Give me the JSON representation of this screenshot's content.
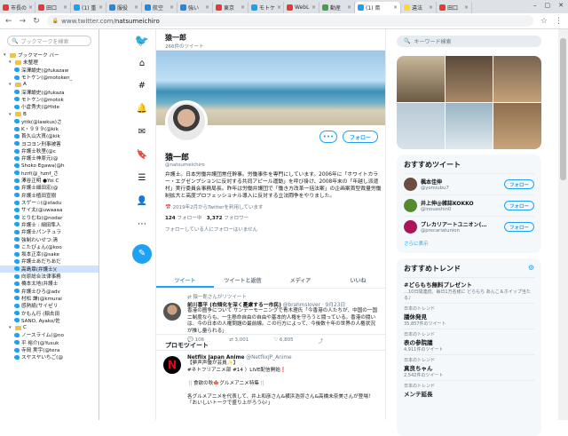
{
  "browser": {
    "tabs": [
      {
        "label": "市長の",
        "color": "#e53935"
      },
      {
        "label": "田口",
        "color": "#e53935"
      },
      {
        "label": "(1) 重",
        "color": "#1da1f2"
      },
      {
        "label": "服役",
        "color": "#1e88e5"
      },
      {
        "label": "航空",
        "color": "#1e88e5"
      },
      {
        "label": "強い",
        "color": "#1e88e5"
      },
      {
        "label": "東京",
        "color": "#e53935"
      },
      {
        "label": "モトケ",
        "color": "#1da1f2"
      },
      {
        "label": "WebL",
        "color": "#e53935"
      },
      {
        "label": "動産",
        "color": "#43a047"
      },
      {
        "label": "(1) 斎",
        "color": "#1da1f2",
        "active": true
      },
      {
        "label": "違法",
        "color": "#fdd835"
      },
      {
        "label": "田口",
        "color": "#e53935"
      }
    ],
    "url_host": "www.twitter.com/",
    "url_path": "natsumeichiro"
  },
  "bookmarks": {
    "search_placeholder": "ブックマークを検索",
    "items": [
      {
        "label": "ブックマーク バー",
        "type": "folder",
        "indent": 0
      },
      {
        "label": "未整理",
        "type": "folder",
        "indent": 1
      },
      {
        "label": "深澤諭史(@fukazaw",
        "type": "tw",
        "indent": 2
      },
      {
        "label": "モトケン(@motoken_",
        "type": "tw",
        "indent": 2
      },
      {
        "label": "A",
        "type": "folder",
        "indent": 1
      },
      {
        "label": "深澤諭史(@fukaza",
        "type": "tw",
        "indent": 2
      },
      {
        "label": "モトケン(@motok",
        "type": "tw",
        "indent": 2
      },
      {
        "label": "小倉秀夫(@Hide",
        "type": "tw",
        "indent": 2
      },
      {
        "label": "B",
        "type": "folder",
        "indent": 1
      },
      {
        "label": "yttk(@lawkus)さ",
        "type": "tw",
        "indent": 2
      },
      {
        "label": "K・９９９(@kik",
        "type": "tw",
        "indent": 2
      },
      {
        "label": "首久山大貫(@kik",
        "type": "tw",
        "indent": 2
      },
      {
        "label": "ヨコヨン刑事被害",
        "type": "tw",
        "indent": 2
      },
      {
        "label": "弁護士秋里(@c",
        "type": "tw",
        "indent": 2
      },
      {
        "label": "弁護士神原元(@",
        "type": "tw",
        "indent": 2
      },
      {
        "label": "Shoko Egawa(@h",
        "type": "tw",
        "indent": 2
      },
      {
        "label": "hzrf(@_hznf_さ",
        "type": "tw",
        "indent": 2
      },
      {
        "label": "澤谷正明 ●Yoi C",
        "type": "tw",
        "indent": 2
      },
      {
        "label": "弁護士細田宏(@",
        "type": "tw",
        "indent": 2
      },
      {
        "label": "弁護士植田宣樹",
        "type": "tw",
        "indent": 2
      },
      {
        "label": "スゲー☆(@stadu",
        "type": "tw",
        "indent": 2
      },
      {
        "label": "サイ太(@uwaaaa",
        "type": "tw",
        "indent": 2
      },
      {
        "label": "とりむね(@nodar",
        "type": "tw",
        "indent": 2
      },
      {
        "label": "弁護士 : 細田隼人",
        "type": "tw",
        "indent": 2
      },
      {
        "label": "弁護士パンチュラ",
        "type": "tw",
        "indent": 2
      },
      {
        "label": "強制わいせつ:清",
        "type": "tw",
        "indent": 2
      },
      {
        "label": "こたびょん(@koo",
        "type": "tw",
        "indent": 2
      },
      {
        "label": "坂本正幸(@sake",
        "type": "tw",
        "indent": 2
      },
      {
        "label": "弁護士あだちあだ",
        "type": "tw",
        "indent": 2
      },
      {
        "label": "高島章(弁護士)(",
        "type": "tw",
        "indent": 2,
        "selected": true
      },
      {
        "label": "向原総合法律事務",
        "type": "tw",
        "indent": 2
      },
      {
        "label": "橋本太地(弁護士",
        "type": "tw",
        "indent": 2
      },
      {
        "label": "弁護士ひろ@adv",
        "type": "tw",
        "indent": 2
      },
      {
        "label": "村松 謙(@kmurai",
        "type": "tw",
        "indent": 2
      },
      {
        "label": "感熱紙(サイゼリ",
        "type": "tw",
        "indent": 2
      },
      {
        "label": "かもん行 (稲去田",
        "type": "tw",
        "indent": 2
      },
      {
        "label": "SANO, Ayako/佐",
        "type": "tw",
        "indent": 2
      },
      {
        "label": "C",
        "type": "folder",
        "indent": 1
      },
      {
        "label": "ノースライム(@no",
        "type": "tw",
        "indent": 2
      },
      {
        "label": "平 裕介(@Yusuk",
        "type": "tw",
        "indent": 2
      },
      {
        "label": "寺岡 実宇(@tera",
        "type": "tw",
        "indent": 2
      },
      {
        "label": "スヤスヤいちご(@",
        "type": "tw",
        "indent": 2
      }
    ]
  },
  "profile": {
    "header_name": "猿一郎",
    "header_tweets": "266件のツイート",
    "name": "猿一郎",
    "handle": "@natsumeichiro",
    "more_label": "•••",
    "follow_label": "フォロー",
    "bio": "弁護士。日本労働弁護団常任幹事。労働事件を専門にしています。2006年に「ホワイトカラー・エグゼンプションに反対する共同アピール運動」を呼び掛け、2008年末の「年越し派遣村」実行委員会事務局長。昨年は労働弁護団で「働き方改革一括法案」の企画案首型裁量労働制拡大と高度プロフェッショナル導入に反対する立法闘争をやりました。",
    "joined": "2019年2月からTwitterを利用しています",
    "following_count": "124",
    "following_label": "フォロー中",
    "followers_count": "3,372",
    "followers_label": "フォロワー",
    "no_follow_note": "フォローしている人にフォローはいません"
  },
  "profile_tabs": [
    "ツイート",
    "ツイートと返信",
    "メディア",
    "いいね"
  ],
  "retweet": {
    "label": "猿一郎さんがリツイート",
    "name": "前川喜平 (右傾化を深く憂慮する一市民)",
    "handle": "@brahmslover",
    "date": "9月23日",
    "body": "香港の圏争について サンデーモーニングで青木理氏「今香港の人たちが、中国の一国二制度ならも、一生懸命自由の自由や基本的人権を守ろうと闘っている。香港の闘いは、今の日本の人権問題の最前線。この行方によって、今後数十年の世界の人権状況が推し量られる」",
    "replies": "106",
    "retweets": "3,001",
    "likes": "6,805"
  },
  "promo": {
    "label": "プロモツイート",
    "name": "Netflix Japan Anime",
    "handle": "@NetflixJP_Anime",
    "lines": [
      "【夢声声優が芸員✨】",
      "#ネトフリアニメ部 #14 〉LIVE配信開始❗",
      "",
      "🍴食欲の秋🍁グルメアニメ特集🍴",
      "",
      "各グルメアニメを代表して、井上和彦さん&横浜浩弥さん&高橋未奈美さんが登場！",
      "「おいしいトークで盛り上がろう🎶」"
    ]
  },
  "right": {
    "search_placeholder": "キーワード検索",
    "rec_title": "おすすめツイート",
    "recs": [
      {
        "name": "楓本佳伸",
        "handle": "@yomiubu7",
        "follow": "フォロー",
        "color": "#6d4c41"
      },
      {
        "name": "井上伸@雑誌KOKKO",
        "handle": "@inoueshin0",
        "follow": "フォロー",
        "color": "#558b2f"
      },
      {
        "name": "プレカリアートユニオン(…",
        "handle": "@precariatunion",
        "follow": "フォロー",
        "color": "#ad1457"
      }
    ],
    "more": "さらに表示",
    "trend_title": "おすすめトレンド",
    "trends": [
      {
        "cat": "",
        "name": "#どらもち無料プレゼント",
        "sub": "…10日間連続、毎日1万名様に どらもち あんこ＆ホイップ当たる♪"
      },
      {
        "cat": "日本のトレンド",
        "name": "議休発見",
        "sub": "35,857件のツイート"
      },
      {
        "cat": "日本のトレンド",
        "name": "表の参院議",
        "sub": "4,911件のツイート"
      },
      {
        "cat": "日本のトレンド",
        "name": "真良ちゃん",
        "sub": "2,542件のツイート"
      },
      {
        "cat": "日本のトレンド",
        "name": "メンテ延長",
        "sub": ""
      }
    ]
  },
  "colors": {
    "accent": "#1da1f2"
  }
}
